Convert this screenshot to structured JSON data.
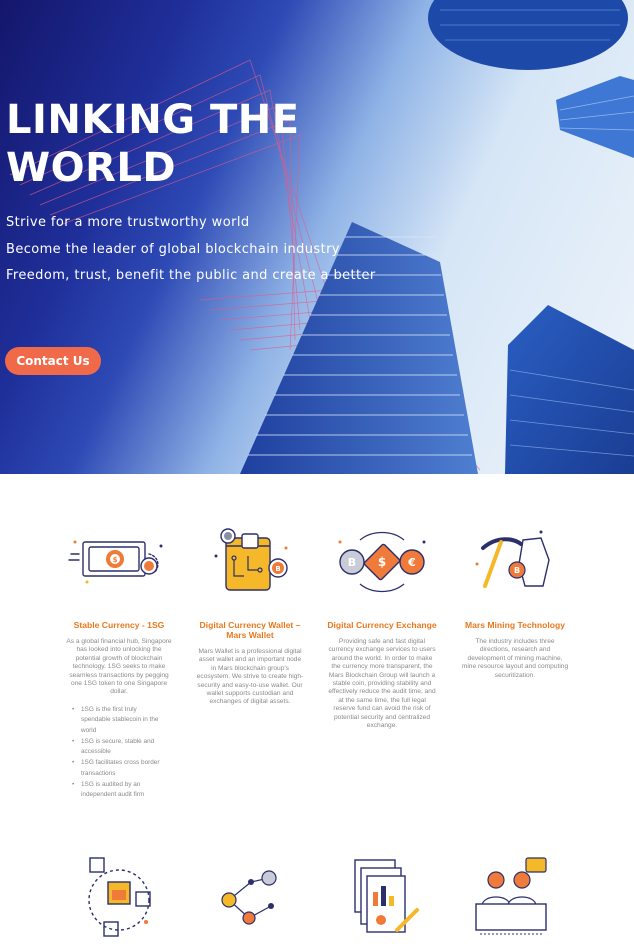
{
  "hero": {
    "title": "LINKING THE WORLD",
    "lines": [
      "Strive for a more trustworthy world",
      "Become the leader of global blockchain industry",
      "Freedom, trust, benefit the public and create a better"
    ],
    "button_label": "Contact Us"
  },
  "features": [
    {
      "title": "Stable Currency - 1SG",
      "text": "As a global financial hub, Singapore has looked into unlocking the potential growth of blockchain technology. 1SG seeks to make seamless transactions by pegging one 1SG token to one Singapore dollar.",
      "bullets": [
        "1SG is the first truly spendable stablecoin in the world",
        "1SG is secure, stable and accessible",
        "1SG facilitates cross border transactions",
        "1SG is audited by an independent audit firm"
      ],
      "icon": "banknote-icon"
    },
    {
      "title": "Digital Currency Wallet – Mars Wallet",
      "text": "Mars Wallet is a professional digital asset wallet and an important node in Mars blockchain group's ecosystem. We strive to create high-security and easy-to-use wallet. Our wallet supports custodian and exchanges of digital assets.",
      "icon": "wallet-icon"
    },
    {
      "title": "Digital Currency Exchange",
      "text": "Providing safe and fast digital currency exchange services to users around the world. In order to make the currency more transparent, the Mars Blockchain Group will launch a stable coin, providing stability and effectively reduce the audit time, and at the same time, the full legal reserve fund can avoid the risk of potential security and centralized exchange.",
      "icon": "exchange-icon"
    },
    {
      "title": "Mars Mining Technology",
      "text": "The industry includes three directions, research and development of mining machine, mine resource layout and computing securitization.",
      "icon": "pickaxe-icon"
    }
  ],
  "bottom_icons": [
    "blockchain-cube-icon",
    "network-nodes-icon",
    "documents-chart-icon",
    "meeting-people-icon"
  ],
  "colors": {
    "accent": "#f06a4a",
    "title_orange": "#e8791f",
    "icon_navy": "#2b2f6b",
    "icon_orange": "#f07a3a",
    "icon_yellow": "#f5b829",
    "hero_navy": "#14166b"
  }
}
